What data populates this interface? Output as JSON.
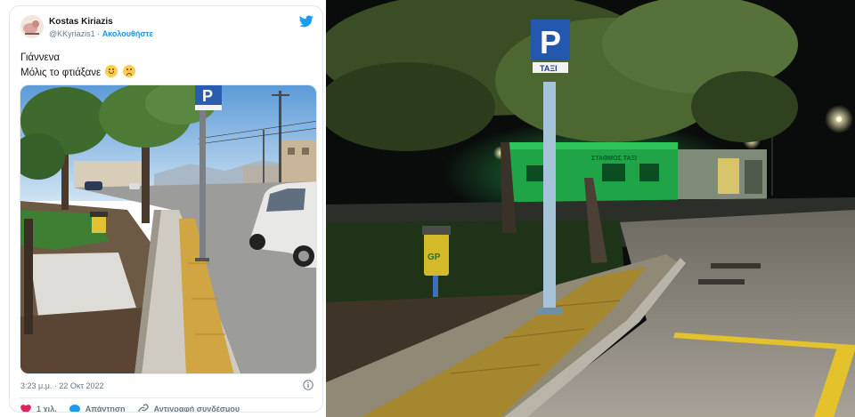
{
  "tweet": {
    "author_name": "Kostas Kiriazis",
    "author_handle": "@KKyriazis1",
    "separator": "·",
    "follow_label": "Ακολουθήστε",
    "text_line1": "Γιάννενα",
    "text_line2": "Μόλις το φτιάξανε",
    "timestamp": "3:23 μ.μ. · 22 Οκτ 2022",
    "actions": {
      "like_count": "1 χιλ.",
      "reply_label": "Απάντηση",
      "copy_link_label": "Αντιγραφή συνδέσμου"
    },
    "colors": {
      "twitter_blue": "#1d9bf0",
      "like_red": "#e0245e",
      "text": "#14171a",
      "muted": "#657786"
    },
    "icons": [
      "twitter-bird-icon",
      "info-icon",
      "heart-icon",
      "reply-bubble-icon",
      "link-icon",
      "smile-emoji",
      "frown-emoji"
    ]
  },
  "day_photo": {
    "parking_sign": "P"
  },
  "night_photo": {
    "parking_sign": "P",
    "taxi_plate": "TAΞI",
    "bin_label": "GP",
    "building_sign": "ΣΤΑΘΜΟΣ ΤΑΞΙ"
  }
}
